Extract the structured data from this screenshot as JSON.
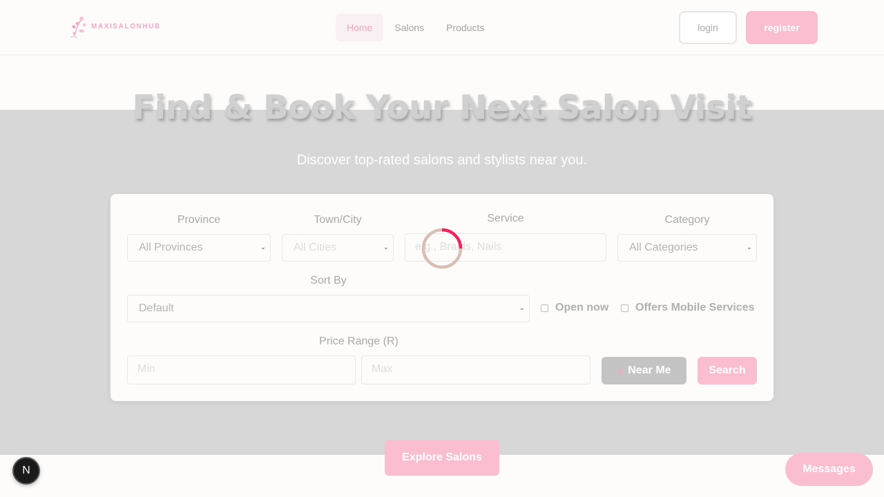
{
  "brand": {
    "name": "MAXISALONHUB"
  },
  "nav": {
    "links": [
      {
        "label": "Home",
        "active": true
      },
      {
        "label": "Salons",
        "active": false
      },
      {
        "label": "Products",
        "active": false
      }
    ],
    "login_label": "login",
    "register_label": "register"
  },
  "hero": {
    "title": "Find & Book Your Next Salon Visit",
    "subtitle": "Discover top-rated salons and stylists near you."
  },
  "search": {
    "province_label": "Province",
    "province_value": "All Provinces",
    "city_label": "Town/City",
    "city_value": "All Cities",
    "service_label": "Service",
    "service_placeholder": "e.g., Braids, Nails",
    "category_label": "Category",
    "category_value": "All Categories",
    "sort_label": "Sort By",
    "sort_value": "Default",
    "open_now_label": "Open now",
    "mobile_label": "Offers Mobile Services",
    "price_label": "Price Range (R)",
    "min_placeholder": "Min",
    "max_placeholder": "Max",
    "near_me_label": "Near Me",
    "search_label": "Search"
  },
  "explore_label": "Explore Salons",
  "messages_label": "Messages",
  "dev_badge": "N",
  "colors": {
    "accent_pink": "#fbbdd0",
    "spinner_pink": "#f0245c",
    "spinner_track": "#d9bfb3",
    "overlay_gray": "#d7d7d7"
  }
}
